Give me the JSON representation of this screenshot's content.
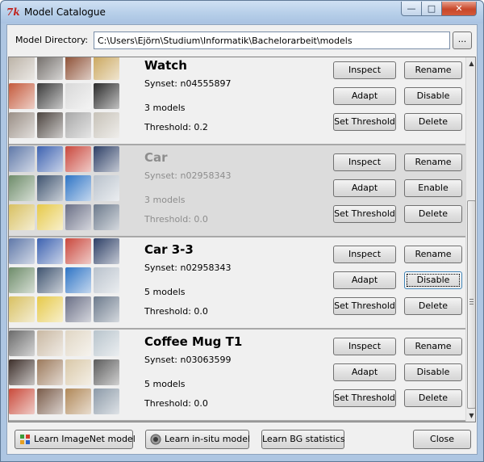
{
  "window": {
    "title": "Model Catalogue",
    "app_icon_text": "7k",
    "controls": {
      "minimize": "—",
      "maximize": "□",
      "close": "✕"
    }
  },
  "directory": {
    "label": "Model Directory:",
    "value": "C:\\Users\\Ejörn\\Studium\\Informatik\\Bachelorarbeit\\models",
    "browse_label": "..."
  },
  "row_buttons": {
    "inspect": "Inspect",
    "rename": "Rename",
    "adapt": "Adapt",
    "set_threshold": "Set Threshold",
    "delete": "Delete"
  },
  "models": [
    {
      "name": "Watch",
      "synset": "Synset: n04555897",
      "count": "3 models",
      "threshold": "Threshold: 0.2",
      "toggle_label": "Disable",
      "disabled": false,
      "thumb_colors": [
        "#b9b0a4",
        "#6f6a66",
        "#8a4b2f",
        "#c9a55a",
        "#c45a3c",
        "#3b3b3b",
        "#d8d8d8",
        "#2a2a2a",
        "#9a8f86",
        "#4d4540",
        "#a7a7a7",
        "#c7c2b8"
      ]
    },
    {
      "name": "Car",
      "synset": "Synset: n02958343",
      "count": "3 models",
      "threshold": "Threshold: 0.0",
      "toggle_label": "Enable",
      "disabled": true,
      "thumb_colors": [
        "#5f78a8",
        "#3d62b0",
        "#c9473c",
        "#2d3f66",
        "#6e8c6a",
        "#3f5470",
        "#2e74c5",
        "#b9c2cc",
        "#d8c061",
        "#e6c94a",
        "#6a6f86",
        "#6c7a8c"
      ]
    },
    {
      "name": "Car 3-3",
      "synset": "Synset: n02958343",
      "count": "5 models",
      "threshold": "Threshold: 0.0",
      "toggle_label": "Disable",
      "disabled": false,
      "thumb_colors": [
        "#5f78a8",
        "#3d62b0",
        "#c9473c",
        "#2d3f66",
        "#6e8c6a",
        "#3f5470",
        "#2e74c5",
        "#b9c2cc",
        "#d8c061",
        "#e6c94a",
        "#6a6f86",
        "#6c7a8c"
      ]
    },
    {
      "name": "Coffee Mug T1",
      "synset": "Synset: n03063599",
      "count": "5 models",
      "threshold": "Threshold: 0.0",
      "toggle_label": "Disable",
      "disabled": false,
      "thumb_colors": [
        "#6b6b6b",
        "#c9b8a2",
        "#e0d6c4",
        "#b8c4cc",
        "#3d2f2a",
        "#9c7a5c",
        "#d9c8a8",
        "#5c5c5c",
        "#c94a3a",
        "#7a5c4a",
        "#b08858",
        "#8c9aa8"
      ]
    }
  ],
  "focused_button": "Car 3-3 / Disable",
  "bottom": {
    "learn_imagenet": "Learn ImageNet model",
    "learn_insitu": "Learn in-situ model",
    "learn_bg": "Learn BG statistics",
    "close": "Close"
  },
  "scrollbar": {
    "position_fraction": 0.39
  }
}
